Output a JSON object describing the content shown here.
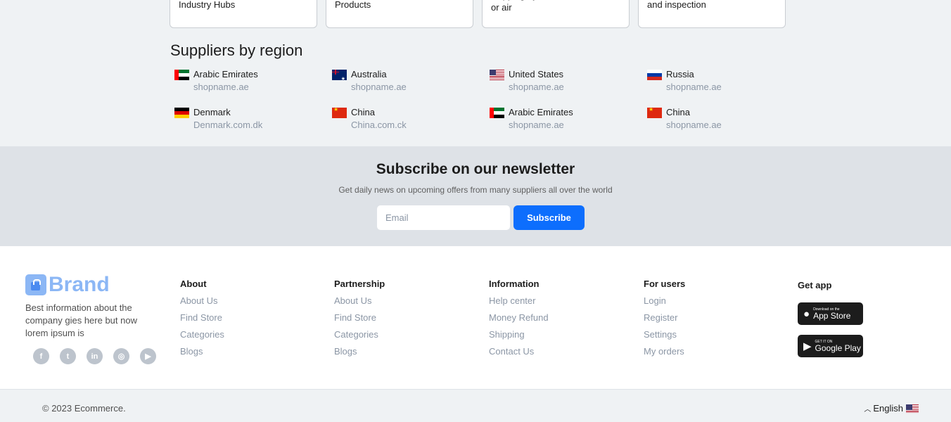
{
  "services": {
    "cards": [
      "Industry Hubs",
      "Products",
      "shipping by ocean\nor air",
      "and inspection"
    ]
  },
  "regions": {
    "title": "Suppliers by region",
    "items": [
      {
        "country": "Arabic Emirates",
        "site": "shopname.ae",
        "flag": "ae"
      },
      {
        "country": "Australia",
        "site": "shopname.ae",
        "flag": "au"
      },
      {
        "country": "United States",
        "site": "shopname.ae",
        "flag": "us"
      },
      {
        "country": "Russia",
        "site": "shopname.ae",
        "flag": "ru"
      },
      {
        "country": "Denmark",
        "site": "Denmark.com.dk",
        "flag": "de"
      },
      {
        "country": "China",
        "site": "China.com.ck",
        "flag": "cn"
      },
      {
        "country": "Arabic Emirates",
        "site": "shopname.ae",
        "flag": "ae"
      },
      {
        "country": "China",
        "site": "shopname.ae",
        "flag": "cn"
      }
    ]
  },
  "newsletter": {
    "title": "Subscribe on our newsletter",
    "subtitle": "Get daily news on upcoming offers from many suppliers all over the world",
    "email_placeholder": "Email",
    "button": "Subscribe"
  },
  "footer": {
    "brand": "Brand",
    "description": "Best information about the company gies here but now lorem ipsum is",
    "socials": [
      "facebook-icon",
      "twitter-icon",
      "linkedin-icon",
      "instagram-icon",
      "youtube-icon"
    ],
    "columns": [
      {
        "title": "About",
        "links": [
          "About Us",
          "Find Store",
          "Categories",
          "Blogs"
        ]
      },
      {
        "title": "Partnership",
        "links": [
          "About Us",
          "Find Store",
          "Categories",
          "Blogs"
        ]
      },
      {
        "title": "Information",
        "links": [
          "Help center",
          "Money Refund",
          "Shipping",
          "Contact Us"
        ]
      },
      {
        "title": "For users",
        "links": [
          "Login",
          "Register",
          "Settings",
          "My orders"
        ]
      }
    ],
    "get_app": "Get app",
    "app_store": {
      "small": "Download on the",
      "big": "App Store"
    },
    "google_play": {
      "small": "GET IT ON",
      "big": "Google Play"
    }
  },
  "bottom": {
    "copyright": "© 2023 Ecommerce.",
    "language": "English"
  }
}
